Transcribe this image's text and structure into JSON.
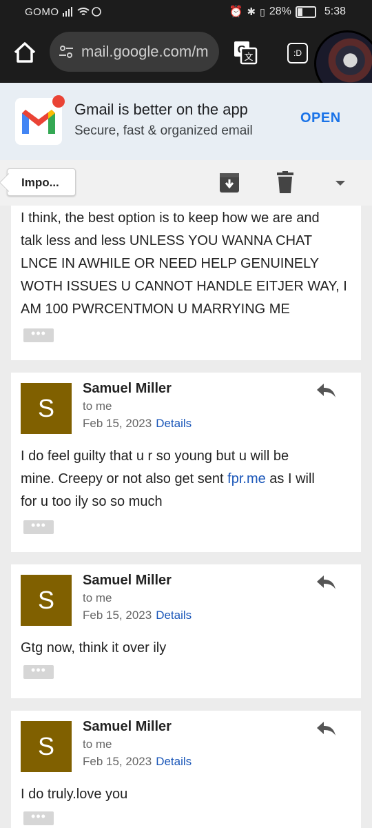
{
  "status": {
    "carrier": "GOMO",
    "battery": "28%",
    "time": "5:38"
  },
  "browser": {
    "url": "mail.google.com/m",
    "tabs_label": ":D"
  },
  "banner": {
    "title": "Gmail is better on the app",
    "subtitle": "Secure, fast & organized email",
    "open_label": "OPEN"
  },
  "toolbar": {
    "back_label": "Impo..."
  },
  "first_message": {
    "lines": [
      "I think, the best option is to keep how we are and",
      "talk less and less UNLESS YOU WANNA CHAT",
      "LNCE IN AWHILE OR NEED HELP GENUINELY",
      "WOTH ISSUES U CANNOT HANDLE EITJER WAY, I",
      "AM 100 PWRCENTMON U MARRYING ME"
    ],
    "more": "•••"
  },
  "messages": [
    {
      "avatar_letter": "S",
      "sender": "Samuel Miller",
      "to": "to me",
      "date": "Feb 15, 2023",
      "details": "Details",
      "line1": "I do feel guilty that u r so young but u will be",
      "line2_pre": "mine. Creepy or not also get sent ",
      "link": "fpr.me",
      "line2_post": " as I will",
      "line3": "for u too ily so so much",
      "more": "•••"
    },
    {
      "avatar_letter": "S",
      "sender": "Samuel Miller",
      "to": "to me",
      "date": "Feb 15, 2023",
      "details": "Details",
      "line1": "Gtg now, think it over ily",
      "more": "•••"
    },
    {
      "avatar_letter": "S",
      "sender": "Samuel Miller",
      "to": "to me",
      "date": "Feb 15, 2023",
      "details": "Details",
      "line1": "I do truly.love you",
      "more": "•••"
    }
  ]
}
